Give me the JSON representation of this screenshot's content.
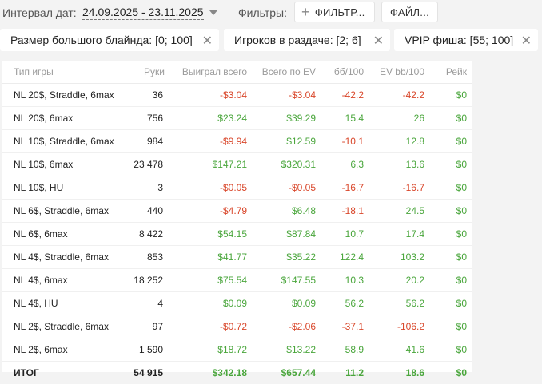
{
  "toolbar": {
    "interval_label": "Интервал дат:",
    "date_range": "24.09.2025 - 23.11.2025",
    "filters_label": "Фильтры:",
    "filter_button": "ФИЛЬТР...",
    "file_button": "ФАЙЛ..."
  },
  "chips": [
    {
      "label": "Размер большого блайнда: [0; 100]"
    },
    {
      "label": "Игроков в раздаче: [2; 6]"
    },
    {
      "label": "VPIP фиша: [55; 100]"
    }
  ],
  "table": {
    "headers": [
      "Тип игры",
      "Руки",
      "Выиграл всего",
      "Всего по EV",
      "бб/100",
      "EV bb/100",
      "Рейк"
    ],
    "rows": [
      [
        "NL 20$, Straddle, 6max",
        "36",
        "-$3.04",
        "-$3.04",
        "-42.2",
        "-42.2",
        "$0"
      ],
      [
        "NL 20$, 6max",
        "756",
        "$23.24",
        "$39.29",
        "15.4",
        "26",
        "$0"
      ],
      [
        "NL 10$, Straddle, 6max",
        "984",
        "-$9.94",
        "$12.59",
        "-10.1",
        "12.8",
        "$0"
      ],
      [
        "NL 10$, 6max",
        "23 478",
        "$147.21",
        "$320.31",
        "6.3",
        "13.6",
        "$0"
      ],
      [
        "NL 10$, HU",
        "3",
        "-$0.05",
        "-$0.05",
        "-16.7",
        "-16.7",
        "$0"
      ],
      [
        "NL 6$, Straddle, 6max",
        "440",
        "-$4.79",
        "$6.48",
        "-18.1",
        "24.5",
        "$0"
      ],
      [
        "NL 6$, 6max",
        "8 422",
        "$54.15",
        "$87.84",
        "10.7",
        "17.4",
        "$0"
      ],
      [
        "NL 4$, Straddle, 6max",
        "853",
        "$41.77",
        "$35.22",
        "122.4",
        "103.2",
        "$0"
      ],
      [
        "NL 4$, 6max",
        "18 252",
        "$75.54",
        "$147.55",
        "10.3",
        "20.2",
        "$0"
      ],
      [
        "NL 4$, HU",
        "4",
        "$0.09",
        "$0.09",
        "56.2",
        "56.2",
        "$0"
      ],
      [
        "NL 2$, Straddle, 6max",
        "97",
        "-$0.72",
        "-$2.06",
        "-37.1",
        "-106.2",
        "$0"
      ],
      [
        "NL 2$, 6max",
        "1 590",
        "$18.72",
        "$13.22",
        "58.9",
        "41.6",
        "$0"
      ]
    ],
    "total": [
      "ИТОГ",
      "54 915",
      "$342.18",
      "$657.44",
      "11.2",
      "18.6",
      "$0"
    ]
  },
  "colors": {
    "positive": "#4aa63c",
    "negative": "#d9472b"
  }
}
